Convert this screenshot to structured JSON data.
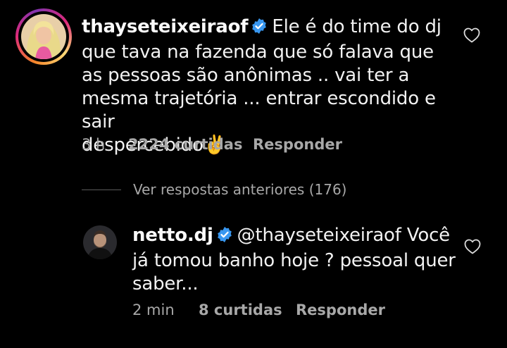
{
  "comment": {
    "username": "thayseteixeiraof",
    "lines": [
      "Ele é do time do dj",
      "que tava na fazenda que só falava que",
      "as pessoas são anônimas .. vai ter a",
      "mesma trajetória ... entrar escondido e sair",
      "despercebido"
    ],
    "emoji": "✌️",
    "time": "3 h",
    "likes": "2224 curtidas",
    "reply_label": "Responder"
  },
  "replies_link": "Ver respostas anteriores (176)",
  "reply": {
    "username": "netto.dj",
    "mention": "@thayseteixeiraof",
    "lines": [
      "Você",
      "já tomou banho hoje ? pessoal quer",
      "saber..."
    ],
    "time": "2 min",
    "likes": "8 curtidas",
    "reply_label": "Responder"
  },
  "colors": {
    "background": "#000000",
    "text": "#f2f2f2",
    "muted": "#a8a8a8",
    "verified": "#3897f0"
  }
}
